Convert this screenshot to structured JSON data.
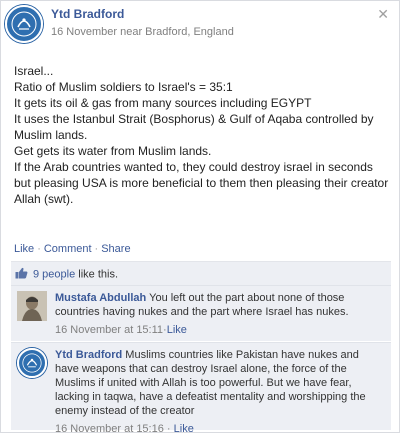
{
  "post": {
    "author": "Ytd Bradford",
    "meta": "16 November near Bradford, England",
    "close_glyph": "✕",
    "lines": [
      "Israel...",
      "Ratio of Muslim soldiers to Israel's = 35:1",
      "It gets its oil & gas from many sources including EGYPT",
      "It uses the Istanbul Strait (Bosphorus) & Gulf of Aqaba controlled by Muslim lands.",
      "Get gets its water from Muslim lands.",
      "If the Arab countries wanted to, they could destroy israel in seconds but pleasing USA is more beneficial to them then pleasing their creator Allah (swt)."
    ]
  },
  "actions": {
    "like": "Like",
    "comment": "Comment",
    "share": "Share",
    "sep": "·"
  },
  "likes": {
    "count_text": "9 people",
    "suffix": " like this."
  },
  "comments": [
    {
      "author": "Mustafa Abdullah",
      "text": " You left out the part about none of those countries having nukes and the part where Israel has nukes.",
      "time": "16 November at 15:11",
      "like": "Like"
    },
    {
      "author": "Ytd Bradford",
      "text": " Muslims countries like Pakistan have nukes and have weapons that can destroy Israel alone, the force of the Muslims if united with Allah is too powerful. But we have fear, lacking in taqwa, have a defeatist mentality and worshipping the enemy instead of the creator",
      "time": "16 November at 15:16",
      "like": "Like"
    }
  ],
  "icons": {
    "avatar": "page-logo-icon",
    "thumb": "thumbs-up-icon",
    "close": "close-icon"
  },
  "colors": {
    "link": "#3b5998",
    "feedback_bg": "#edeff4",
    "meta": "#7f7f7f"
  }
}
